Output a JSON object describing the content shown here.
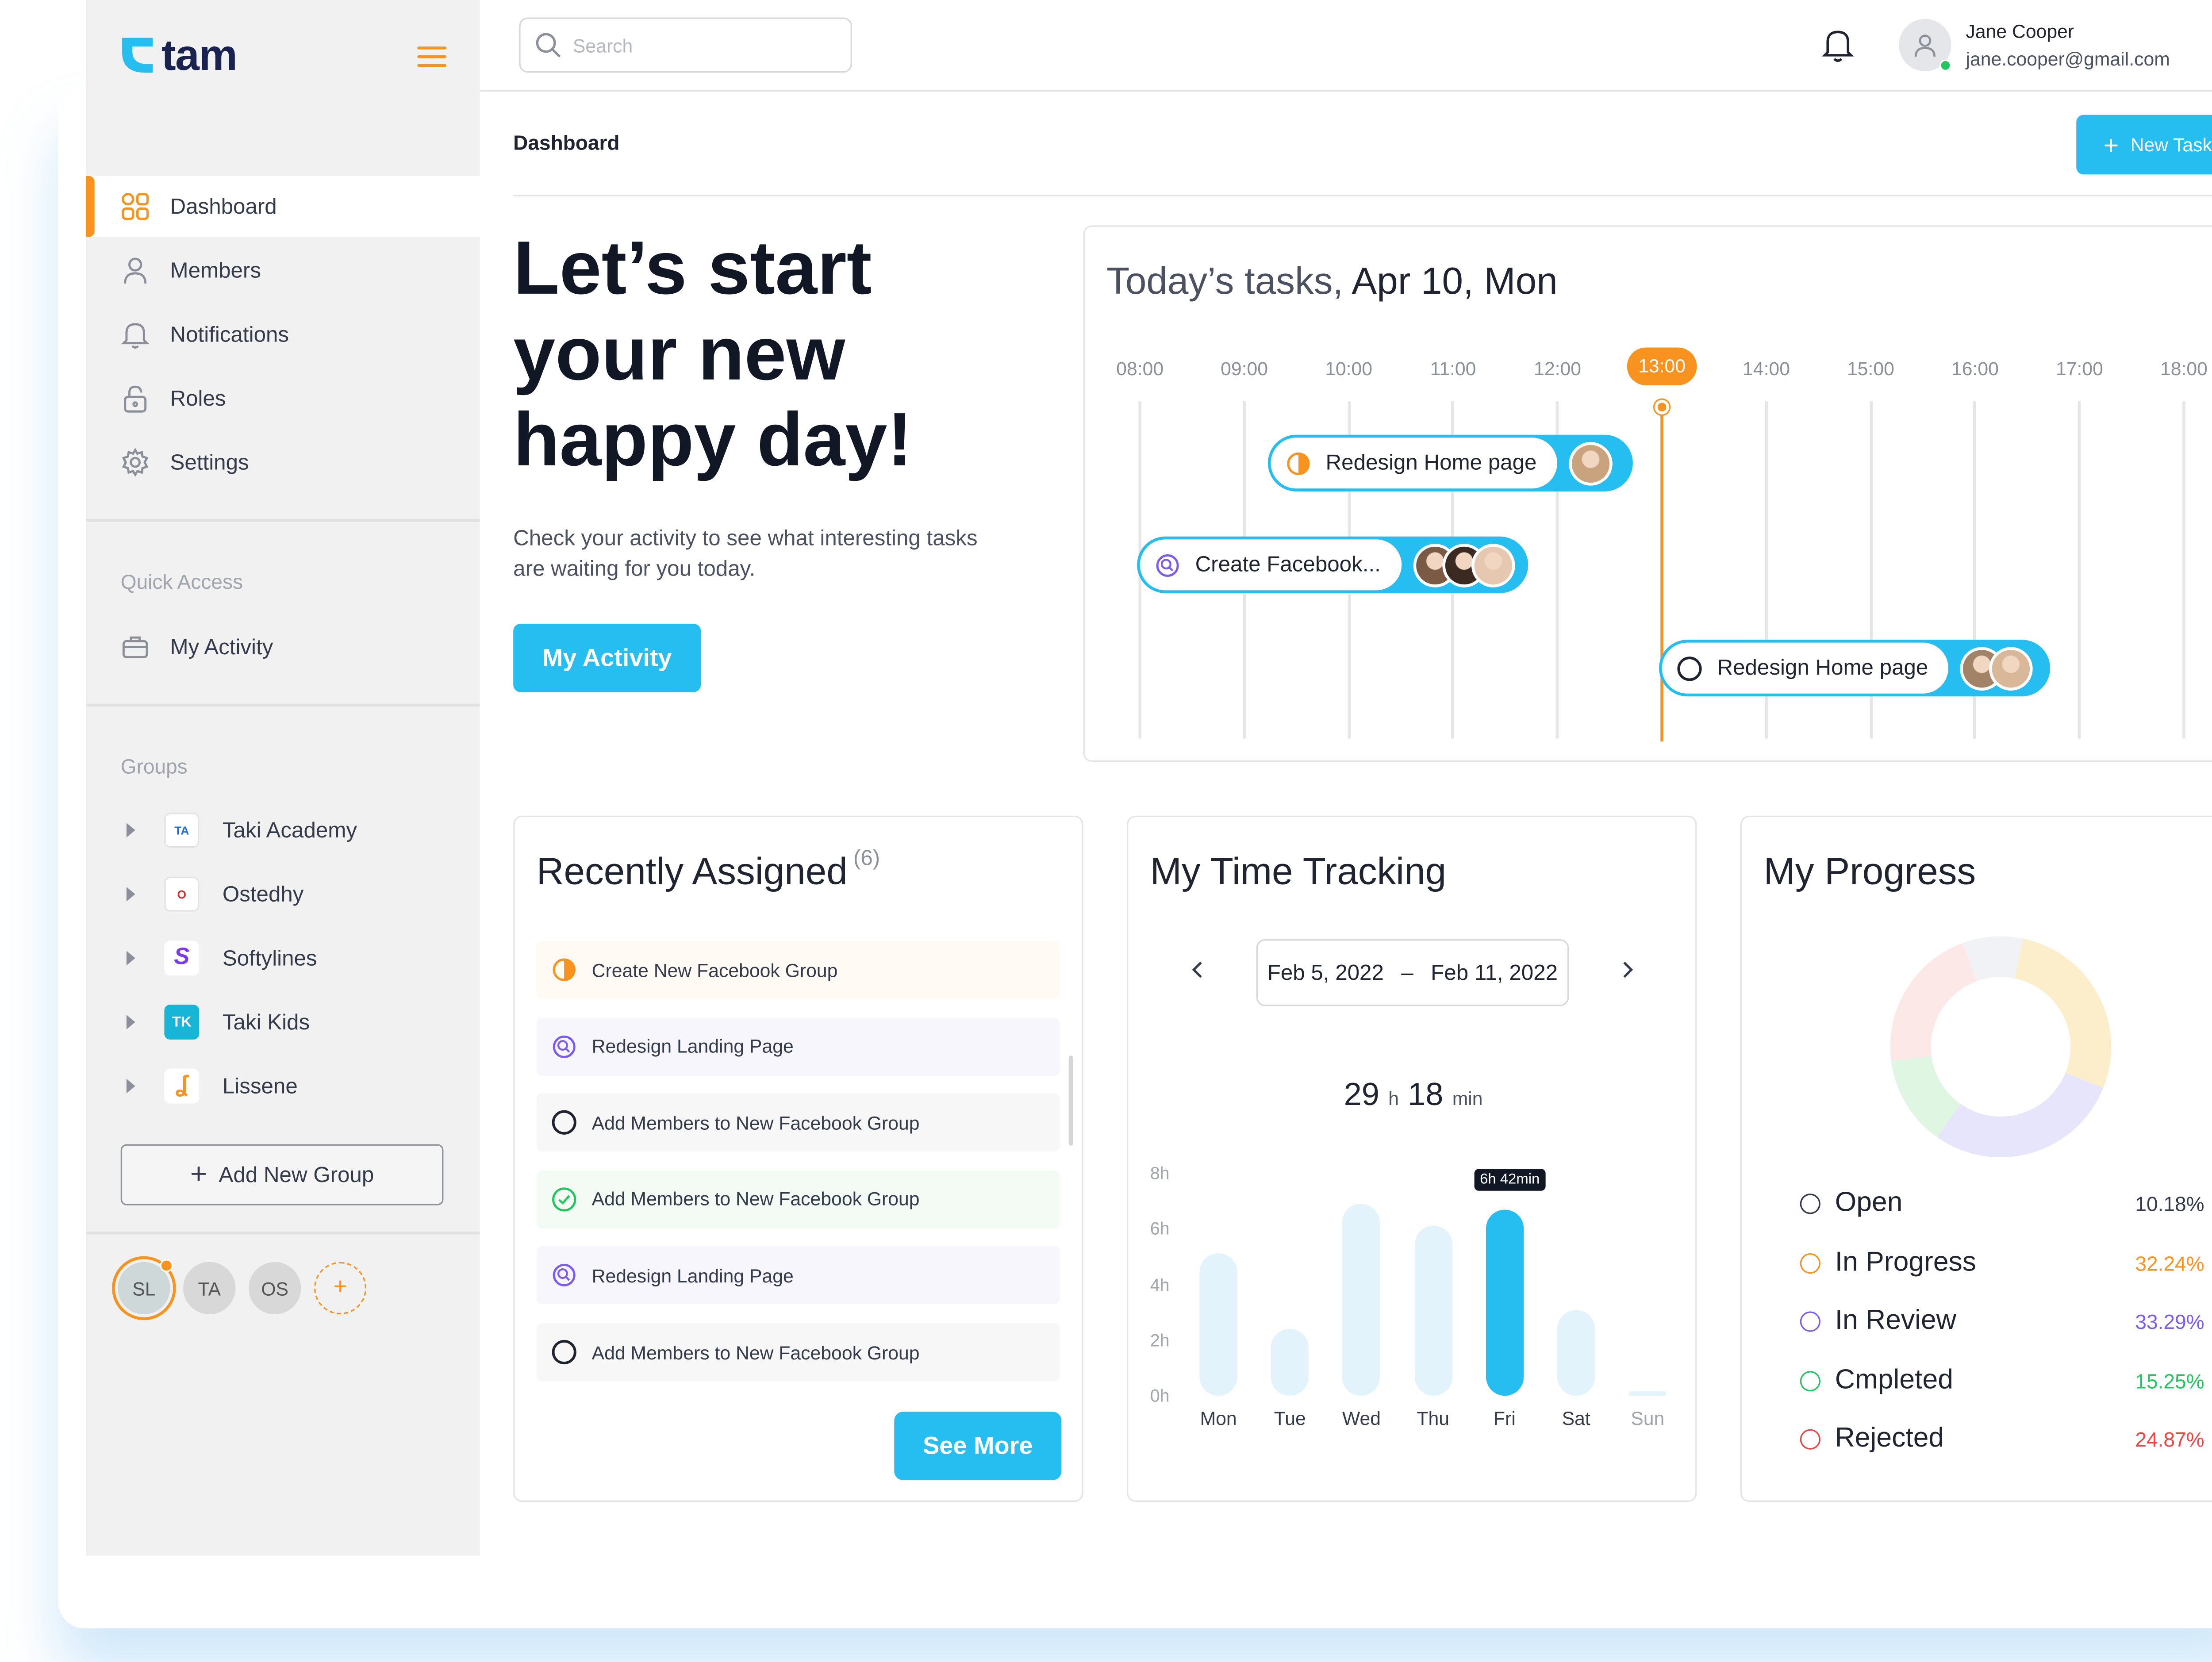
{
  "app": {
    "brand": "tam"
  },
  "sidebar": {
    "nav": [
      {
        "label": "Dashboard",
        "icon": "dashboard-icon",
        "active": true
      },
      {
        "label": "Members",
        "icon": "user-icon"
      },
      {
        "label": "Notifications",
        "icon": "bell-icon"
      },
      {
        "label": "Roles",
        "icon": "lock-icon"
      },
      {
        "label": "Settings",
        "icon": "gear-icon"
      }
    ],
    "quick_access_title": "Quick Access",
    "quick_access": [
      {
        "label": "My Activity",
        "icon": "briefcase-icon"
      }
    ],
    "groups_title": "Groups",
    "groups": [
      {
        "label": "Taki Academy"
      },
      {
        "label": "Ostedhy"
      },
      {
        "label": "Softylines"
      },
      {
        "label": "Taki Kids"
      },
      {
        "label": "Lissene"
      }
    ],
    "add_group_label": "Add New Group",
    "members": [
      "SL",
      "TA",
      "OS"
    ]
  },
  "topbar": {
    "search_placeholder": "Search",
    "user": {
      "name": "Jane Cooper",
      "email": "jane.cooper@gmail.com"
    }
  },
  "header": {
    "breadcrumb": "Dashboard",
    "new_task_label": "New Task"
  },
  "hero": {
    "title": "Let’s start your new happy day!",
    "subtitle": "Check your activity to see what interesting tasks are waiting for you today.",
    "button": "My Activity"
  },
  "todays_tasks": {
    "title_prefix": "Today’s tasks,",
    "title_date": "Apr 10, Mon",
    "hours": [
      "08:00",
      "09:00",
      "10:00",
      "11:00",
      "12:00",
      "13:00",
      "14:00",
      "15:00",
      "16:00",
      "17:00",
      "18:00"
    ],
    "current_hour": "13:00",
    "tasks": [
      {
        "label": "Redesign Home page",
        "status": "in-progress",
        "start": "09:15",
        "end": "12:45"
      },
      {
        "label": "Create Facebook...",
        "status": "in-review",
        "start": "08:00",
        "end": "11:45"
      },
      {
        "label": "Redesign Home page",
        "status": "open",
        "start": "13:00",
        "end": "16:45"
      }
    ]
  },
  "recently_assigned": {
    "title": "Recently Assigned",
    "count": "(6)",
    "items": [
      {
        "label": "Create New Facebook Group",
        "status": "in-progress"
      },
      {
        "label": "Redesign Landing Page",
        "status": "in-review"
      },
      {
        "label": "Add Members to New Facebook Group",
        "status": "open"
      },
      {
        "label": "Add Members to New Facebook Group",
        "status": "completed"
      },
      {
        "label": "Redesign Landing Page",
        "status": "in-review"
      },
      {
        "label": "Add Members to New Facebook Group",
        "status": "open"
      }
    ],
    "see_more": "See More"
  },
  "time_tracking": {
    "title": "My Time Tracking",
    "date_from": "Feb 5, 2022",
    "date_sep": "–",
    "date_to": "Feb 11, 2022",
    "total_hours": "29",
    "total_hours_unit": "h",
    "total_minutes": "18",
    "total_minutes_unit": "min",
    "tooltip": "6h 42min",
    "chart_data": {
      "type": "bar",
      "categories": [
        "Mon",
        "Tue",
        "Wed",
        "Thu",
        "Fri",
        "Sat",
        "Sun"
      ],
      "values": [
        5.1,
        2.4,
        6.9,
        6.1,
        6.7,
        3.1,
        0.1
      ],
      "highlight": "Fri",
      "y_ticks": [
        "0h",
        "2h",
        "4h",
        "6h",
        "8h"
      ],
      "ylim": [
        0,
        8
      ]
    }
  },
  "progress": {
    "title": "My Progress",
    "chart_data": {
      "type": "pie",
      "labels": [
        "Open",
        "In Progress",
        "In Review",
        "Cmpleted",
        "Rejected"
      ],
      "values": [
        10.18,
        32.24,
        33.29,
        15.25,
        24.87
      ]
    },
    "legend": [
      {
        "label": "Open",
        "value": "10.18%",
        "color": "#333a4a"
      },
      {
        "label": "In Progress",
        "value": "32.24%",
        "color": "#f7931e"
      },
      {
        "label": "In Review",
        "value": "33.29%",
        "color": "#7c5cf0"
      },
      {
        "label": "Cmpleted",
        "value": "15.25%",
        "color": "#22c55e"
      },
      {
        "label": "Rejected",
        "value": "24.87%",
        "color": "#ef4444"
      }
    ]
  },
  "colors": {
    "accent": "#26bdf0",
    "brand_orange": "#f7931e",
    "donut": [
      "#f1f2f5",
      "#fdeecb",
      "#e6e5fb",
      "#dff6e2",
      "#fde8e8"
    ]
  }
}
